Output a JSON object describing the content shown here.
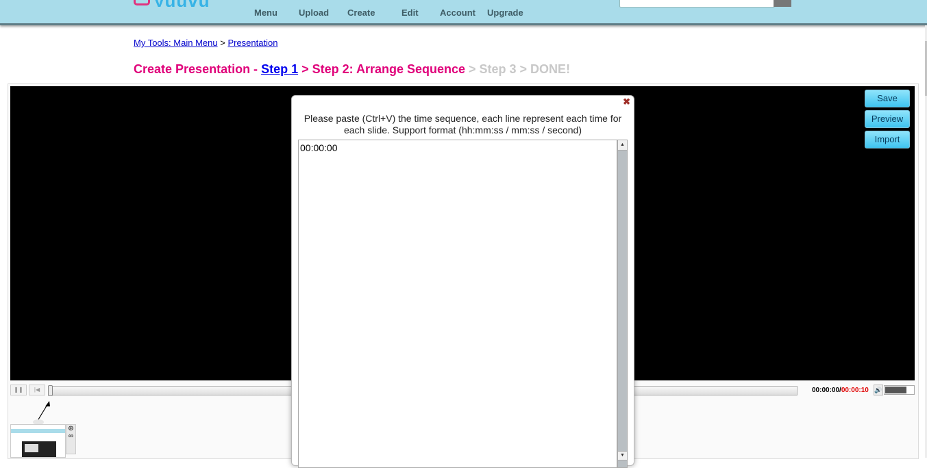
{
  "header": {
    "logo_text": "yuuvu",
    "nav": [
      "Menu",
      "Upload",
      "Create",
      "Edit",
      "Account",
      "Upgrade"
    ]
  },
  "breadcrumb": {
    "main_menu": "My Tools: Main Menu",
    "separator": ">",
    "presentation": "Presentation"
  },
  "title": {
    "prefix": "Create Presentation - ",
    "step1": "Step 1",
    "step2": " > Step 2: Arrange Sequence",
    "rest": " > Step 3 > DONE!"
  },
  "side_buttons": {
    "save": "Save",
    "preview": "Preview",
    "import": "Import"
  },
  "player": {
    "current_time": "00:00:00",
    "time_separator": "/",
    "total_time": "00:00:10",
    "volume_level": 0.75
  },
  "dialog": {
    "close_glyph": "✖",
    "message": "Please paste (Ctrl+V) the time sequence, each line represent each time for each slide. Support format (hh:mm:ss / mm:ss / second)",
    "textarea_value": "00:00:00"
  },
  "colors": {
    "header_bg": "#a9dcea",
    "title_pink": "#e0007a",
    "link_blue": "#0000ee",
    "button_cyan": "#3fc4f0",
    "total_time_red": "#e00000"
  }
}
